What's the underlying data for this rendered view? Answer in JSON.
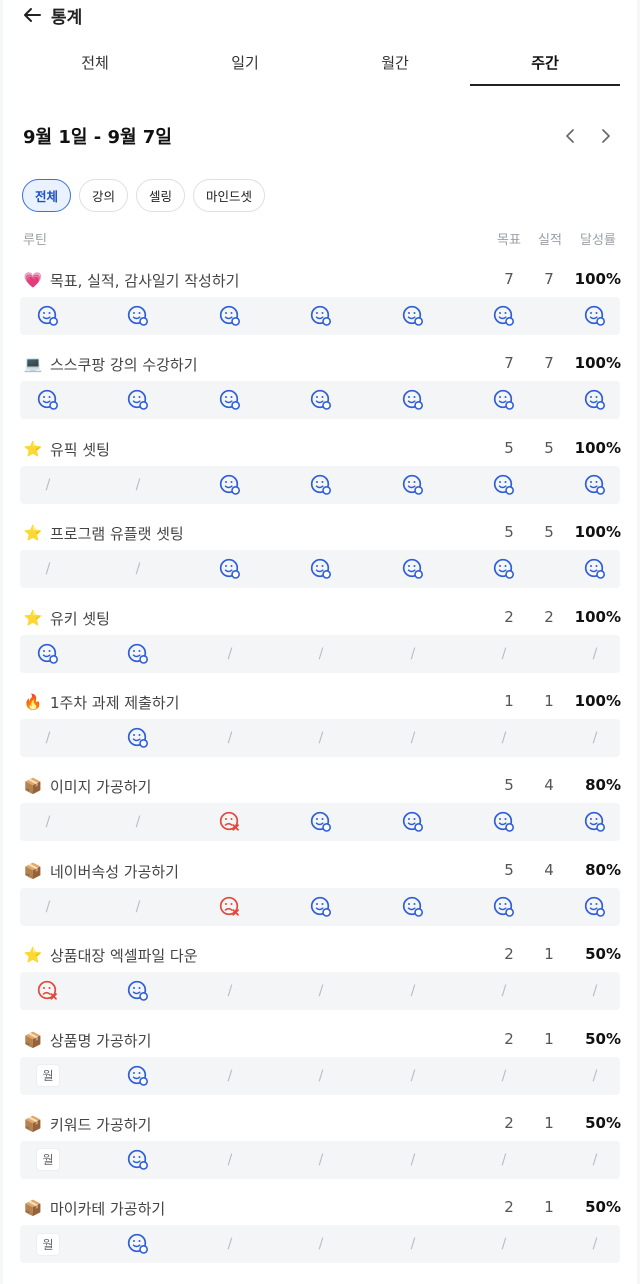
{
  "header": {
    "title": "통계"
  },
  "tabs": [
    {
      "label": "전체",
      "active": false
    },
    {
      "label": "일기",
      "active": false
    },
    {
      "label": "월간",
      "active": false
    },
    {
      "label": "주간",
      "active": true
    }
  ],
  "week": {
    "range": "9월 1일 - 9월 7일"
  },
  "filters": [
    {
      "label": "전체",
      "active": true
    },
    {
      "label": "강의",
      "active": false
    },
    {
      "label": "셀링",
      "active": false
    },
    {
      "label": "마인드셋",
      "active": false
    }
  ],
  "columns": {
    "routine": "루틴",
    "goal": "목표",
    "actual": "실적",
    "rate": "달성률"
  },
  "routines": [
    {
      "emoji": "💗",
      "name": "목표, 실적, 감사일기 작성하기",
      "goal": "7",
      "actual": "7",
      "rate": "100%",
      "days": [
        "done",
        "done",
        "done",
        "done",
        "done",
        "done",
        "done"
      ]
    },
    {
      "emoji": "💻",
      "name": "스스쿠팡 강의 수강하기",
      "goal": "7",
      "actual": "7",
      "rate": "100%",
      "days": [
        "done",
        "done",
        "done",
        "done",
        "done",
        "done",
        "done"
      ]
    },
    {
      "emoji": "⭐",
      "name": "유픽 셋팅",
      "goal": "5",
      "actual": "5",
      "rate": "100%",
      "days": [
        "none",
        "none",
        "done",
        "done",
        "done",
        "done",
        "done"
      ]
    },
    {
      "emoji": "⭐",
      "name": "프로그램 유플랫 셋팅",
      "goal": "5",
      "actual": "5",
      "rate": "100%",
      "days": [
        "none",
        "none",
        "done",
        "done",
        "done",
        "done",
        "done"
      ]
    },
    {
      "emoji": "⭐",
      "name": "유키 셋팅",
      "goal": "2",
      "actual": "2",
      "rate": "100%",
      "days": [
        "done",
        "done",
        "none",
        "none",
        "none",
        "none",
        "none"
      ]
    },
    {
      "emoji": "🔥",
      "name": "1주차 과제 제출하기",
      "goal": "1",
      "actual": "1",
      "rate": "100%",
      "days": [
        "none",
        "done",
        "none",
        "none",
        "none",
        "none",
        "none"
      ]
    },
    {
      "emoji": "📦",
      "name": "이미지 가공하기",
      "goal": "5",
      "actual": "4",
      "rate": "80%",
      "days": [
        "none",
        "none",
        "fail",
        "done",
        "done",
        "done",
        "done"
      ]
    },
    {
      "emoji": "📦",
      "name": "네이버속성 가공하기",
      "goal": "5",
      "actual": "4",
      "rate": "80%",
      "days": [
        "none",
        "none",
        "fail",
        "done",
        "done",
        "done",
        "done"
      ]
    },
    {
      "emoji": "⭐",
      "name": "상품대장 엑셀파일 다운",
      "goal": "2",
      "actual": "1",
      "rate": "50%",
      "days": [
        "fail",
        "done",
        "none",
        "none",
        "none",
        "none",
        "none"
      ]
    },
    {
      "emoji": "📦",
      "name": "상품명 가공하기",
      "goal": "2",
      "actual": "1",
      "rate": "50%",
      "days": [
        "월",
        "done",
        "none",
        "none",
        "none",
        "none",
        "none"
      ]
    },
    {
      "emoji": "📦",
      "name": "키워드 가공하기",
      "goal": "2",
      "actual": "1",
      "rate": "50%",
      "days": [
        "월",
        "done",
        "none",
        "none",
        "none",
        "none",
        "none"
      ]
    },
    {
      "emoji": "📦",
      "name": "마이카테 가공하기",
      "goal": "2",
      "actual": "1",
      "rate": "50%",
      "days": [
        "월",
        "done",
        "none",
        "none",
        "none",
        "none",
        "none"
      ]
    }
  ],
  "colors": {
    "accent": "#3b6fe0",
    "done": "#2f5fd8",
    "fail": "#e2483b"
  }
}
